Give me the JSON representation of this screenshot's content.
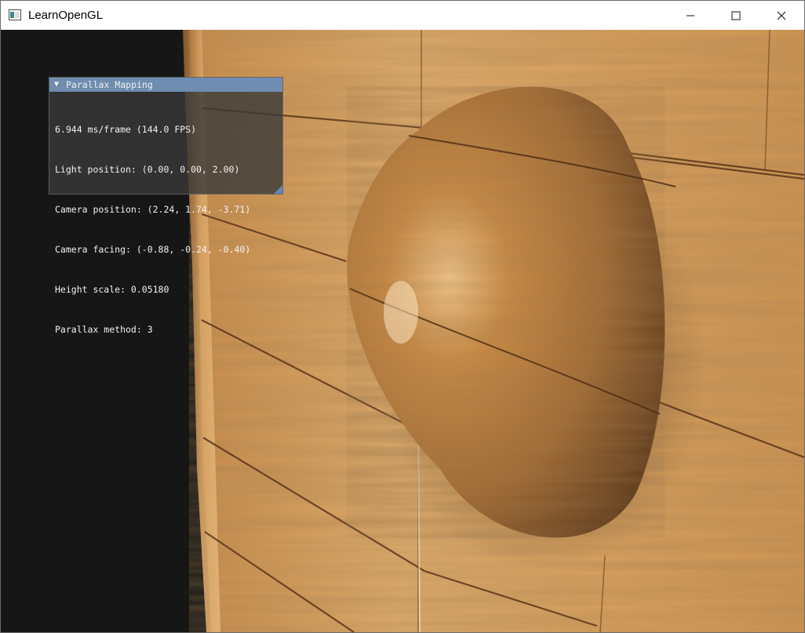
{
  "window": {
    "title": "LearnOpenGL",
    "app_icon": "window-app-icon",
    "controls": {
      "minimize_icon": "minimize-icon",
      "maximize_icon": "maximize-icon",
      "close_icon": "close-icon"
    }
  },
  "scene": {
    "description_icon": "wood-wall-sphere-render",
    "colors": {
      "void": "#161616",
      "wood_light": "#d8a15c",
      "wood_dark": "#a96a2e",
      "groove": "#5a3519"
    }
  },
  "overlay": {
    "title": "Parallax Mapping",
    "collapse_icon": "triangle-down-icon",
    "lines": [
      "6.944 ms/frame (144.0 FPS)",
      "Light position: (0.00, 0.00, 2.00)",
      "Camera position: (2.24, 1.74, -3.71)",
      "Camera facing: (-0.88, -0.24, -0.40)",
      "Height scale: 0.05180",
      "Parallax method: 3"
    ],
    "colors": {
      "title_bar": "#6f8db0",
      "panel_bg": "#3a3a3a",
      "text": "#f2f2f2",
      "grip": "#5f88c0"
    }
  }
}
